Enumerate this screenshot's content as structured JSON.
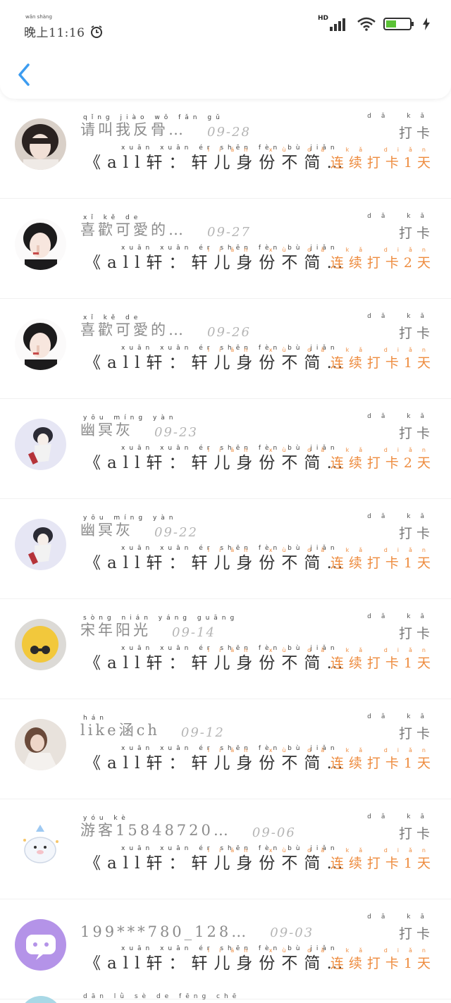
{
  "status_bar": {
    "time": "晚上11:16",
    "time_ruby": "wǎn shàng",
    "network": "HD"
  },
  "colors": {
    "accent_blue": "#3c9cf0",
    "streak_orange": "#ee8c3f",
    "name_gray": "#8c8c8c"
  },
  "rows": [
    {
      "name": "请叫我反骨…",
      "name_ruby": "qǐng jiào wǒ fǎn gǔ",
      "date": "09-28",
      "message": "《all轩：轩儿身份不简…",
      "message_ruby": "xuān   xuān ér shēn fèn bù jiǎn",
      "checkin": "打卡",
      "checkin_ruby": "dǎ kǎ",
      "streak": "连续打卡1天",
      "streak_ruby": "lián xù dǎ kǎ diǎn"
    },
    {
      "name": "喜歡可愛的…",
      "name_ruby": "xǐ   kě   de",
      "date": "09-27",
      "message": "《all轩：轩儿身份不简…",
      "message_ruby": "xuān   xuān ér shēn fèn bù jiǎn",
      "checkin": "打卡",
      "checkin_ruby": "dǎ kǎ",
      "streak": "连续打卡2天",
      "streak_ruby": "lián xù dǎ kǎ diǎn"
    },
    {
      "name": "喜歡可愛的…",
      "name_ruby": "xǐ   kě   de",
      "date": "09-26",
      "message": "《all轩：轩儿身份不简…",
      "message_ruby": "xuān   xuān ér shēn fèn bù jiǎn",
      "checkin": "打卡",
      "checkin_ruby": "dǎ kǎ",
      "streak": "连续打卡1天",
      "streak_ruby": "lián xù dǎ kǎ diǎn"
    },
    {
      "name": "幽冥灰",
      "name_ruby": "yōu míng yàn",
      "date": "09-23",
      "message": "《all轩：轩儿身份不简…",
      "message_ruby": "xuān   xuān ér shēn fèn bù jiǎn",
      "checkin": "打卡",
      "checkin_ruby": "dǎ kǎ",
      "streak": "连续打卡2天",
      "streak_ruby": "lián xù dǎ kǎ diǎn"
    },
    {
      "name": "幽冥灰",
      "name_ruby": "yōu míng yàn",
      "date": "09-22",
      "message": "《all轩：轩儿身份不简…",
      "message_ruby": "xuān   xuān ér shēn fèn bù jiǎn",
      "checkin": "打卡",
      "checkin_ruby": "dǎ kǎ",
      "streak": "连续打卡1天",
      "streak_ruby": "lián xù dǎ kǎ diǎn"
    },
    {
      "name": "宋年阳光",
      "name_ruby": "sòng nián yáng guāng",
      "date": "09-14",
      "message": "《all轩：轩儿身份不简…",
      "message_ruby": "xuān   xuān ér shēn fèn bù jiǎn",
      "checkin": "打卡",
      "checkin_ruby": "dǎ kǎ",
      "streak": "连续打卡1天",
      "streak_ruby": "lián xù dǎ kǎ diǎn"
    },
    {
      "name": "like涵ch",
      "name_ruby": "hán",
      "date": "09-12",
      "message": "《all轩：轩儿身份不简…",
      "message_ruby": "xuān   xuān ér shēn fèn bù jiǎn",
      "checkin": "打卡",
      "checkin_ruby": "dǎ kǎ",
      "streak": "连续打卡1天",
      "streak_ruby": "lián xù dǎ kǎ diǎn"
    },
    {
      "name": "游客15848720…",
      "name_ruby": "yóu kè",
      "date": "09-06",
      "message": "《all轩：轩儿身份不简…",
      "message_ruby": "xuān   xuān ér shēn fèn bù jiǎn",
      "checkin": "打卡",
      "checkin_ruby": "dǎ kǎ",
      "streak": "连续打卡1天",
      "streak_ruby": "lián xù dǎ kǎ diǎn"
    },
    {
      "name": "199***780_128…",
      "name_ruby": "",
      "date": "09-03",
      "message": "《all轩：轩儿身份不简…",
      "message_ruby": "xuān   xuān ér shēn fèn bù jiǎn",
      "checkin": "打卡",
      "checkin_ruby": "dǎ kǎ",
      "streak": "连续打卡1天",
      "streak_ruby": "lián xù dǎ kǎ diǎn"
    }
  ],
  "partial_row": {
    "name_ruby": "dān lǜ sè de fēng chē"
  }
}
